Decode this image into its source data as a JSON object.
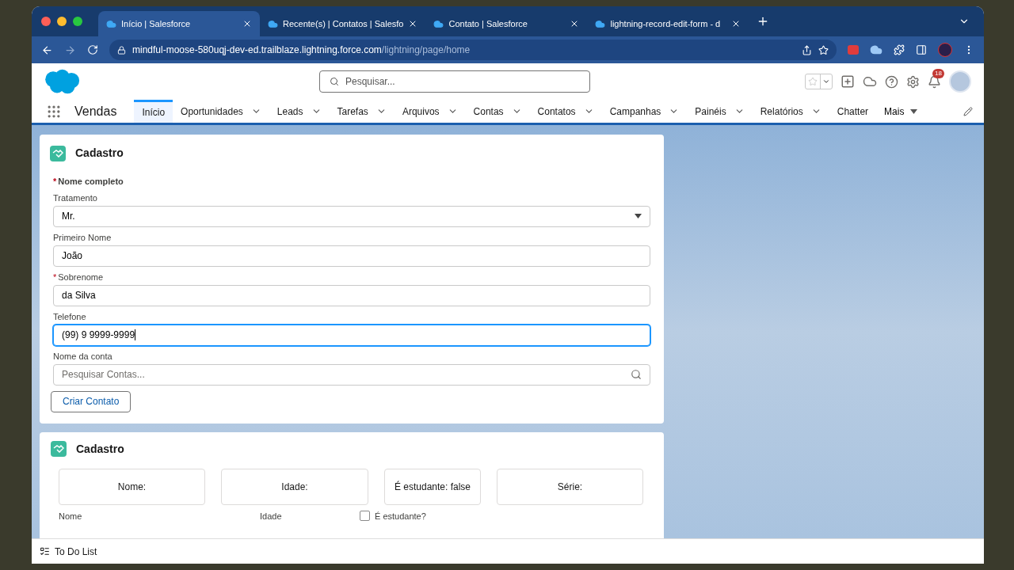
{
  "browser": {
    "tabs": [
      {
        "title": "Início | Salesforce",
        "selected": true
      },
      {
        "title": "Recente(s) | Contatos | Salesfo",
        "selected": false
      },
      {
        "title": "Contato | Salesforce",
        "selected": false
      },
      {
        "title": "lightning-record-edit-form - d",
        "selected": false
      }
    ],
    "url_host": "mindful-moose-580uqj-dev-ed.trailblaze.lightning.force.com",
    "url_path": "/lightning/page/home"
  },
  "header": {
    "search_placeholder": "Pesquisar...",
    "notification_count": "18"
  },
  "nav": {
    "app_name": "Vendas",
    "items": [
      {
        "label": "Início",
        "selected": true,
        "menu": false
      },
      {
        "label": "Oportunidades",
        "selected": false,
        "menu": true
      },
      {
        "label": "Leads",
        "selected": false,
        "menu": true
      },
      {
        "label": "Tarefas",
        "selected": false,
        "menu": true
      },
      {
        "label": "Arquivos",
        "selected": false,
        "menu": true
      },
      {
        "label": "Contas",
        "selected": false,
        "menu": true
      },
      {
        "label": "Contatos",
        "selected": false,
        "menu": true
      },
      {
        "label": "Campanhas",
        "selected": false,
        "menu": true
      },
      {
        "label": "Painéis",
        "selected": false,
        "menu": true
      },
      {
        "label": "Relatórios",
        "selected": false,
        "menu": true
      },
      {
        "label": "Chatter",
        "selected": false,
        "menu": false
      }
    ],
    "more": "Mais"
  },
  "form_card": {
    "title": "Cadastro",
    "group_required_mark": "*",
    "group_label": "Nome completo",
    "fields": [
      {
        "label": "Tratamento",
        "kind": "select",
        "value": "Mr.",
        "focused": false
      },
      {
        "label": "Primeiro Nome",
        "kind": "text",
        "value": "João",
        "focused": false
      },
      {
        "required_mark": "*",
        "label": "Sobrenome",
        "kind": "text",
        "value": "da Silva",
        "focused": false
      },
      {
        "label": "Telefone",
        "kind": "text",
        "value": "(99) 9 9999-9999",
        "focused": true
      },
      {
        "label": "Nome da conta",
        "kind": "lookup",
        "placeholder": "Pesquisar Contas...",
        "focused": false
      }
    ],
    "button": "Criar Contato"
  },
  "display_card": {
    "title": "Cadastro",
    "boxes": [
      "Nome:",
      "Idade:",
      "É estudante: false",
      "Série:"
    ],
    "inputs": [
      {
        "label": "Nome",
        "kind": "label"
      },
      {
        "label": "Idade",
        "kind": "label"
      },
      {
        "label": "É estudante?",
        "kind": "checkbox",
        "checked": false
      }
    ]
  },
  "utility_bar": {
    "item": "To Do List"
  }
}
